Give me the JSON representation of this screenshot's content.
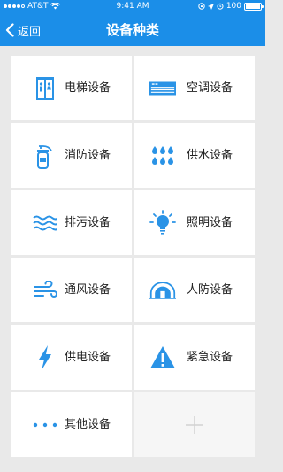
{
  "status": {
    "carrier": "AT&T",
    "time": "9:41 AM",
    "battery": "100"
  },
  "nav": {
    "back_label": "返回",
    "title": "设备种类"
  },
  "colors": {
    "brand": "#1b8ee8",
    "icon": "#2a93e6",
    "background": "#e9e9e9"
  },
  "categories": [
    {
      "label": "电梯设备",
      "icon": "elevator-icon"
    },
    {
      "label": "空调设备",
      "icon": "air-conditioner-icon"
    },
    {
      "label": "消防设备",
      "icon": "fire-extinguisher-icon"
    },
    {
      "label": "供水设备",
      "icon": "water-drops-icon"
    },
    {
      "label": "排污设备",
      "icon": "sewage-waves-icon"
    },
    {
      "label": "照明设备",
      "icon": "light-bulb-icon"
    },
    {
      "label": "通风设备",
      "icon": "wind-icon"
    },
    {
      "label": "人防设备",
      "icon": "civil-defense-shelter-icon"
    },
    {
      "label": "供电设备",
      "icon": "lightning-icon"
    },
    {
      "label": "紧急设备",
      "icon": "warning-icon"
    },
    {
      "label": "其他设备",
      "icon": "more-dots-icon"
    }
  ],
  "add_tile_icon": "plus-icon"
}
